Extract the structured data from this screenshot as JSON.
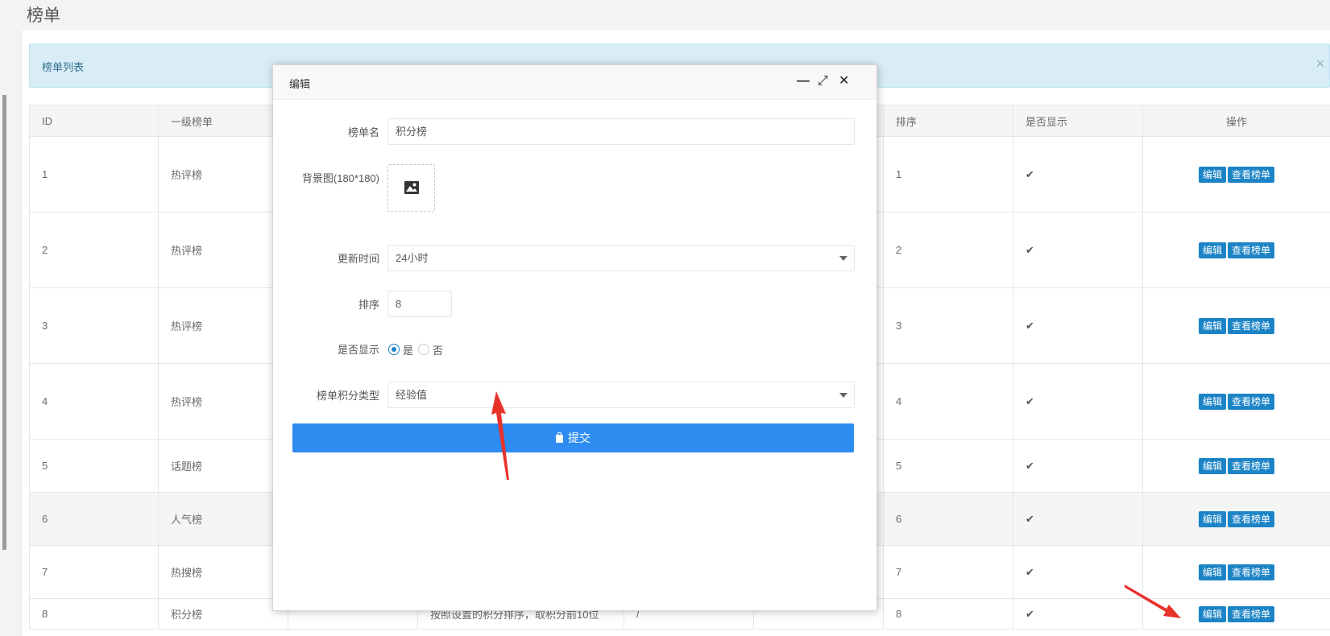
{
  "page": {
    "title": "榜单"
  },
  "alert": {
    "text": "榜单列表",
    "close": "×"
  },
  "table": {
    "headers": [
      "ID",
      "一级榜单",
      "",
      "",
      "",
      "",
      "排序",
      "是否显示",
      "操作"
    ],
    "rows": [
      {
        "id": "1",
        "primary": "热评榜",
        "c3": "",
        "desc": "",
        "c5": "",
        "c6": "",
        "sort": "1",
        "shown": "✔",
        "edit": "编辑",
        "view": "查看榜单"
      },
      {
        "id": "2",
        "primary": "热评榜",
        "c3": "",
        "desc": "",
        "c5": "",
        "c6": "",
        "sort": "2",
        "shown": "✔",
        "edit": "编辑",
        "view": "查看榜单"
      },
      {
        "id": "3",
        "primary": "热评榜",
        "c3": "",
        "desc": "",
        "c5": "",
        "c6": "",
        "sort": "3",
        "shown": "✔",
        "edit": "编辑",
        "view": "查看榜单"
      },
      {
        "id": "4",
        "primary": "热评榜",
        "c3": "",
        "desc": "",
        "c5": "",
        "c6": "",
        "sort": "4",
        "shown": "✔",
        "edit": "编辑",
        "view": "查看榜单"
      },
      {
        "id": "5",
        "primary": "话题榜",
        "c3": "",
        "desc": "",
        "c5": "",
        "c6": "",
        "sort": "5",
        "shown": "✔",
        "edit": "编辑",
        "view": "查看榜单"
      },
      {
        "id": "6",
        "primary": "人气榜",
        "c3": "",
        "desc": "",
        "c5": "",
        "c6": "",
        "sort": "6",
        "shown": "✔",
        "edit": "编辑",
        "view": "查看榜单"
      },
      {
        "id": "7",
        "primary": "热搜榜",
        "c3": "",
        "desc": "",
        "c5": "",
        "c6": "",
        "sort": "7",
        "shown": "✔",
        "edit": "编辑",
        "view": "查看榜单"
      },
      {
        "id": "8",
        "primary": "积分榜",
        "c3": "",
        "desc": "按照设置的积分排序，取积分前10位",
        "c5": "/",
        "c6": "",
        "sort": "8",
        "shown": "✔",
        "edit": "编辑",
        "view": "查看榜单"
      }
    ]
  },
  "modal": {
    "title": "编辑",
    "controls": {
      "minimize": "—",
      "maximize": "⤢",
      "close": "✕"
    },
    "form": {
      "name_label": "榜单名",
      "name_value": "积分榜",
      "bg_label": "背景图(180*180)",
      "update_label": "更新时间",
      "update_value": "24小时",
      "sort_label": "排序",
      "sort_value": "8",
      "show_label": "是否显示",
      "show_yes": "是",
      "show_no": "否",
      "score_type_label": "榜单积分类型",
      "score_type_value": "经验值",
      "submit": "提交"
    }
  },
  "colors": {
    "primary_button": "#2d8cf0",
    "action_button": "#1c84c6",
    "alert_bg": "#d9edf7",
    "annotation_arrow": "#e8322c"
  }
}
